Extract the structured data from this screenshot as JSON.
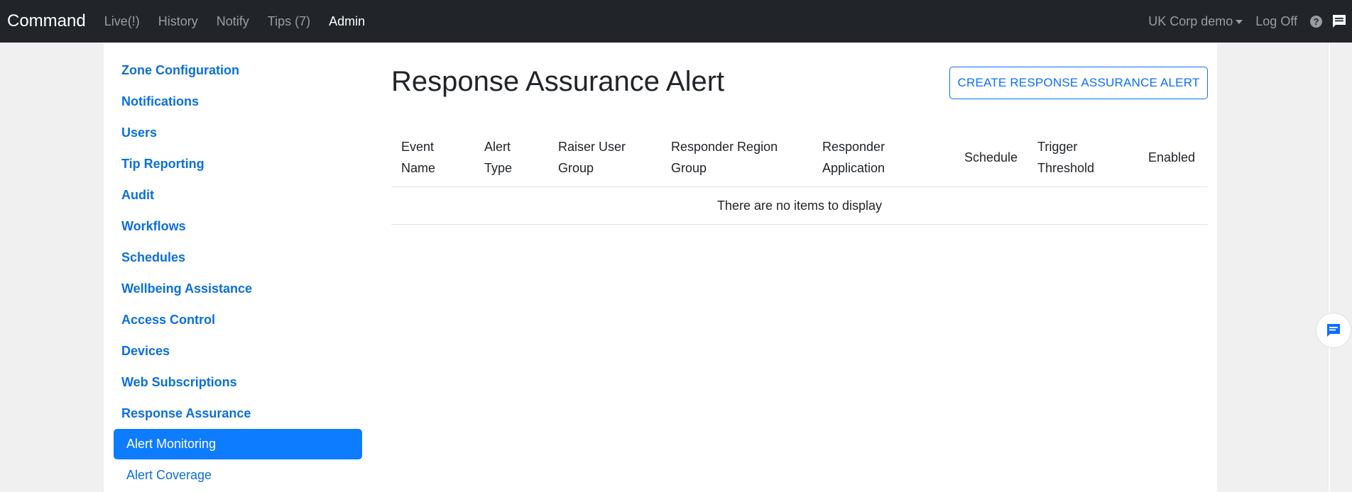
{
  "navbar": {
    "brand": "Command",
    "links": [
      "Live(!)",
      "History",
      "Notify",
      "Tips (7)",
      "Admin"
    ],
    "org": "UK Corp demo",
    "logoff": "Log Off",
    "help_symbol": "?",
    "icons": {
      "help": "question-circle-icon",
      "chat": "chat-icon"
    }
  },
  "sidebar": {
    "items": [
      "Zone Configuration",
      "Notifications",
      "Users",
      "Tip Reporting",
      "Audit",
      "Workflows",
      "Schedules",
      "Wellbeing Assistance",
      "Access Control",
      "Devices",
      "Web Subscriptions",
      "Response Assurance"
    ],
    "subitems": [
      "Alert Monitoring",
      "Alert Coverage"
    ],
    "active_subitem": "Alert Monitoring"
  },
  "main": {
    "title": "Response Assurance Alert",
    "create_button": "CREATE RESPONSE ASSURANCE ALERT",
    "table": {
      "columns": [
        [
          "Event",
          "Name"
        ],
        [
          "Alert",
          "Type"
        ],
        [
          "Raiser User",
          "Group"
        ],
        [
          "Responder Region",
          "Group"
        ],
        [
          "Responder",
          "Application"
        ],
        [
          "Schedule"
        ],
        [
          "Trigger",
          "Threshold"
        ],
        [
          "Enabled"
        ]
      ],
      "empty_message": "There are no items to display"
    }
  },
  "colors": {
    "navbar_bg": "#212529",
    "link_blue": "#0a6fe0",
    "active_bg": "#0d7cff",
    "page_bg": "#f0f0f0"
  }
}
